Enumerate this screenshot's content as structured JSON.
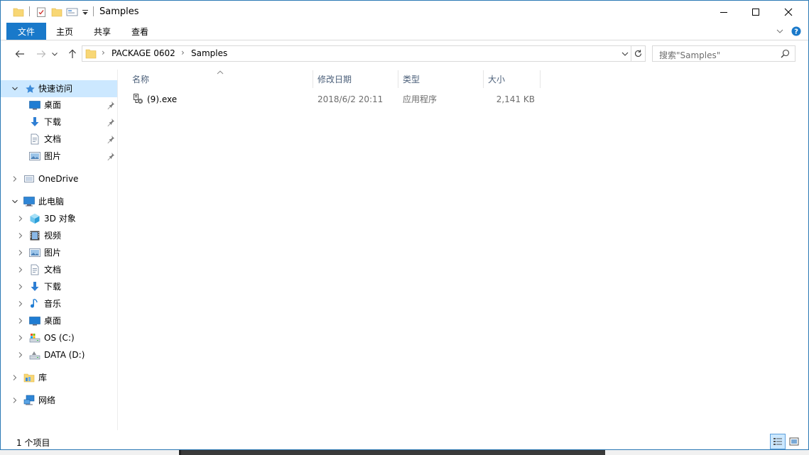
{
  "window": {
    "title": "Samples"
  },
  "ribbon": {
    "tabs": [
      {
        "label": "文件"
      },
      {
        "label": "主页"
      },
      {
        "label": "共享"
      },
      {
        "label": "查看"
      }
    ]
  },
  "address": {
    "segments": [
      "PACKAGE 0602",
      "Samples"
    ]
  },
  "search": {
    "placeholder": "搜索\"Samples\""
  },
  "sidebar": {
    "quick_access": {
      "label": "快速访问",
      "items": [
        {
          "label": "桌面",
          "icon": "desktop-icon"
        },
        {
          "label": "下载",
          "icon": "download-icon"
        },
        {
          "label": "文档",
          "icon": "document-icon"
        },
        {
          "label": "图片",
          "icon": "picture-icon"
        }
      ]
    },
    "onedrive": {
      "label": "OneDrive"
    },
    "this_pc": {
      "label": "此电脑",
      "items": [
        {
          "label": "3D 对象",
          "icon": "cube-icon"
        },
        {
          "label": "视频",
          "icon": "video-icon"
        },
        {
          "label": "图片",
          "icon": "picture-icon"
        },
        {
          "label": "文档",
          "icon": "document-icon"
        },
        {
          "label": "下载",
          "icon": "download-icon"
        },
        {
          "label": "音乐",
          "icon": "music-icon"
        },
        {
          "label": "桌面",
          "icon": "desktop-icon"
        },
        {
          "label": "OS (C:)",
          "icon": "drive-icon"
        },
        {
          "label": "DATA (D:)",
          "icon": "drive-icon"
        }
      ]
    },
    "library": {
      "label": "库"
    },
    "network": {
      "label": "网络"
    }
  },
  "columns": {
    "name": "名称",
    "modified": "修改日期",
    "type": "类型",
    "size": "大小"
  },
  "files": [
    {
      "name": "(9).exe",
      "modified": "2018/6/2 20:11",
      "type": "应用程序",
      "size": "2,141 KB"
    }
  ],
  "status": {
    "text": "1 个项目"
  },
  "colors": {
    "accent": "#1979ca",
    "selection": "#cce8ff",
    "header_text": "#4c607a"
  }
}
